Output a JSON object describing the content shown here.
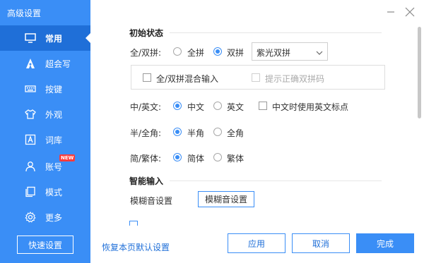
{
  "app_title": "高级设置",
  "sidebar": {
    "items": [
      {
        "label": "常用",
        "icon": "monitor-icon",
        "active": true
      },
      {
        "label": "超会写",
        "icon": "pen-nib-icon"
      },
      {
        "label": "按键",
        "icon": "keyboard-icon"
      },
      {
        "label": "外观",
        "icon": "tshirt-icon"
      },
      {
        "label": "词库",
        "icon": "letter-a-box-icon"
      },
      {
        "label": "账号",
        "icon": "user-icon",
        "badge": "NEW"
      },
      {
        "label": "模式",
        "icon": "copy-pages-icon"
      },
      {
        "label": "更多",
        "icon": "gear-icon"
      }
    ],
    "quick_settings_label": "快速设置"
  },
  "sections": {
    "initial": "初始状态",
    "smart": "智能输入"
  },
  "pinyin": {
    "label": "全/双拼:",
    "option_full": "全拼",
    "option_double": "双拼",
    "selected": "双拼",
    "scheme_value": "紫光双拼",
    "mixed_label": "全/双拼混合输入",
    "hint_label": "提示正确双拼码"
  },
  "lang": {
    "label": "中/英文:",
    "option_cn": "中文",
    "option_en": "英文",
    "selected": "中文",
    "punct_label": "中文时使用英文标点"
  },
  "width": {
    "label": "半/全角:",
    "option_half": "半角",
    "option_full": "全角",
    "selected": "半角"
  },
  "script": {
    "label": "简/繁体:",
    "option_simp": "简体",
    "option_trad": "繁体",
    "selected": "简体"
  },
  "fuzzy": {
    "label": "模糊音设置",
    "button": "模糊音设置"
  },
  "footer": {
    "restore_link": "恢复本页默认设置",
    "apply": "应用",
    "cancel": "取消",
    "done": "完成"
  },
  "colors": {
    "accent": "#3a8ef6",
    "sidebar_active": "#1f6fd8"
  }
}
